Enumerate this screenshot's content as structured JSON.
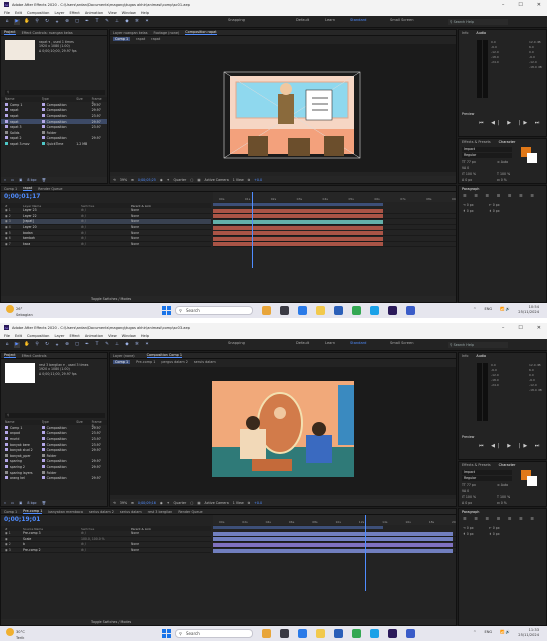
{
  "window_buttons": [
    "–",
    "☐",
    "✕"
  ],
  "menu": [
    "File",
    "Edit",
    "Composition",
    "Layer",
    "Effect",
    "Animation",
    "View",
    "Window",
    "Help"
  ],
  "toolbar": {
    "snapping": "Snapping",
    "workspaces": [
      "Default",
      "Learn",
      "Standard",
      "Small Screen"
    ],
    "search_placeholder": "Search Help"
  },
  "audio": {
    "tabs": [
      "Info",
      "Audio"
    ],
    "db_left": [
      "0.0",
      "-6.0",
      "-12.0",
      "-18.0",
      "-24.0"
    ],
    "db_right": [
      "12.0 dB",
      "6.0",
      "0.0",
      "-6.0",
      "-12.0",
      "-18.0 dB"
    ]
  },
  "preview": {
    "label": "Preview",
    "controls": "⏮ ◀| ▶ |▶ ⏭"
  },
  "character": {
    "tabs": [
      "Effects & Presets",
      "Character"
    ],
    "font": "Impact",
    "style": "Regular",
    "size": "77 px",
    "leading": "Auto",
    "tracking": "0",
    "scale_v": "100 %",
    "scale_h": "100 %",
    "baseline": "0 px",
    "tsume": "0 %",
    "fill_color": "#e07818"
  },
  "paragraph": {
    "label": "Paragraph",
    "indent1": "0 px",
    "indent2": "0 px",
    "space1": "0 px",
    "space2": "0 px"
  },
  "shots": [
    {
      "title": "Adobe After Effects 2020 - C:\\Users\\ardan\\Documents\\magang\\tugas akhir\\animasi\\comp\\sc01.aep",
      "project_tab": "Project",
      "effect_tab": "Effect Controls: ruangan kelas",
      "thumb_name": "rapat ▾ , used 1 times",
      "thumb_info": [
        "1920 x 1080 (1.00)",
        "Δ 0;00;10;00, 29.97 fps"
      ],
      "search_placeholder": "",
      "project_cols": [
        "Name",
        "Type",
        "Size",
        "Frame R..."
      ],
      "project_items": [
        {
          "name": "Comp 1",
          "type": "Composition",
          "size": "",
          "fr": "29.97",
          "color": "lav",
          "sel": false
        },
        {
          "name": "rapat",
          "type": "Composition",
          "size": "",
          "fr": "29.97",
          "color": "lav",
          "sel": false
        },
        {
          "name": "rapat",
          "type": "Composition",
          "size": "",
          "fr": "23.97",
          "color": "lav",
          "sel": false
        },
        {
          "name": "rapat",
          "type": "Composition",
          "size": "",
          "fr": "29.97",
          "color": "lav",
          "sel": true
        },
        {
          "name": "rapat 3",
          "type": "Composition",
          "size": "",
          "fr": "23.97",
          "color": "lav",
          "sel": false
        },
        {
          "name": "Solids",
          "type": "Folder",
          "size": "",
          "fr": "",
          "color": "gray",
          "sel": false
        },
        {
          "name": "rapat 2",
          "type": "Composition",
          "size": "",
          "fr": "29.97",
          "color": "lav",
          "sel": false
        },
        {
          "name": "rapat 3.mov",
          "type": "QuickTime",
          "size": "1.2 MB",
          "fr": "",
          "color": "teal",
          "sel": false
        }
      ],
      "project_foot": "8 bpc",
      "layer_tab": "Layer  ruangan kelas",
      "footage_tab": "Footage  (none)",
      "comp_tab": "Composition  rapat",
      "breadcrumb": [
        "Comp 1",
        "rapat",
        "rapat"
      ],
      "viewer_foot": [
        "39%",
        "0;00;05;25",
        "Quarter",
        "Active Camera",
        "1 View",
        "+0.0"
      ],
      "timeline_tabs": [
        "Comp 1",
        "rapat",
        "Render Queue"
      ],
      "timecode": "0;00;01;17",
      "ruler_ticks": [
        "00s",
        "01s",
        "02s",
        "03s",
        "04s",
        "05s",
        "06s",
        "07s",
        "08s",
        "09s"
      ],
      "tl_cols": [
        "#",
        "Layer Name",
        "Switches",
        "Parent & Link"
      ],
      "layers": [
        {
          "num": "1",
          "name": "Layer 23",
          "sw": "⚙ /",
          "parent": "None",
          "color": "#b85a4a",
          "sel": false
        },
        {
          "num": "2",
          "name": "Layer 22",
          "sw": "⚙ /",
          "parent": "None",
          "color": "#b85a4a",
          "sel": false
        },
        {
          "num": "3",
          "name": "[rapat]",
          "sw": "⚙ /",
          "parent": "None",
          "color": "#6ac0b8",
          "sel": true
        },
        {
          "num": "4",
          "name": "Layer 20",
          "sw": "⚙ /",
          "parent": "None",
          "color": "#b85a4a",
          "sel": false
        },
        {
          "num": "5",
          "name": "badan",
          "sw": "⚙ /",
          "parent": "None",
          "color": "#b85a4a",
          "sel": false
        },
        {
          "num": "6",
          "name": "tambah",
          "sw": "⚙ /",
          "parent": "None",
          "color": "#b85a4a",
          "sel": false
        },
        {
          "num": "7",
          "name": "kaca",
          "sw": "⚙ /",
          "parent": "None",
          "color": "#b85a4a",
          "sel": false
        }
      ],
      "playhead_frac": 0.16,
      "tl_foot": "Toggle Switches / Modes",
      "scene": "meeting",
      "taskbar": {
        "weather1": "26°",
        "weather2": "Sebagian",
        "search": "Search",
        "time": "10:54",
        "date": "25/11/2024",
        "lang": "ENG"
      }
    },
    {
      "title": "Adobe After Effects 2020 - C:\\Users\\ardan\\Documents\\magang\\tugas akhir\\animasi\\comp\\sc03.aep",
      "project_tab": "Project",
      "effect_tab": "Effect Controls",
      "thumb_name": "rest 3 bergilan ▾ , used 3 times",
      "thumb_info": [
        "1920 x 1080 (1.00)",
        "Δ 0;00;11;00, 29.97 fps"
      ],
      "search_placeholder": "",
      "project_cols": [
        "Name",
        "Type",
        "Size",
        "Frame R..."
      ],
      "project_items": [
        {
          "name": "Comp 1",
          "type": "Composition",
          "size": "",
          "fr": "29.97",
          "color": "lav",
          "sel": false
        },
        {
          "name": "anpad",
          "type": "Composition",
          "size": "",
          "fr": "23.97",
          "color": "lav",
          "sel": false
        },
        {
          "name": "murid",
          "type": "Composition",
          "size": "",
          "fr": "23.97",
          "color": "lav",
          "sel": false
        },
        {
          "name": "banyak bere",
          "type": "Composition",
          "size": "",
          "fr": "23.97",
          "color": "lav",
          "sel": false
        },
        {
          "name": "banyak stud 2",
          "type": "Composition",
          "size": "",
          "fr": "29.97",
          "color": "lav",
          "sel": false
        },
        {
          "name": "banyak_pper",
          "type": "Folder",
          "size": "",
          "fr": "",
          "color": "gray",
          "sel": false
        },
        {
          "name": "sparing",
          "type": "Composition",
          "size": "",
          "fr": "29.97",
          "color": "lav",
          "sel": false
        },
        {
          "name": "sparing 2",
          "type": "Composition",
          "size": "",
          "fr": "29.97",
          "color": "lav",
          "sel": false
        },
        {
          "name": "sparing layers",
          "type": "Folder",
          "size": "",
          "fr": "",
          "color": "gray",
          "sel": false
        },
        {
          "name": "orang kel",
          "type": "Composition",
          "size": "",
          "fr": "29.97",
          "color": "lav",
          "sel": false
        }
      ],
      "project_foot": "8 bpc",
      "layer_tab": "Layer  (none)",
      "footage_tab": "",
      "comp_tab": "Composition  Comp 1",
      "breadcrumb": [
        "Comp 1",
        "Pre-comp 1",
        "pergus dalam 2",
        "seruis dalam"
      ],
      "viewer_foot": [
        "39%",
        "0;00;09;16",
        "Quarter",
        "Active Camera",
        "1 View",
        "+0.0"
      ],
      "timeline_tabs": [
        "Comp 1",
        "Pre-comp 1",
        "banyakan membaca",
        "serius dalam 2",
        "serius dalam",
        "rest 3 bergilan",
        "Render Queue"
      ],
      "timecode": "0;00;19;01",
      "ruler_ticks": [
        "00s",
        "02s",
        "04s",
        "06s",
        "08s",
        "10s",
        "12s",
        "14s",
        "16s",
        "18s",
        "20s"
      ],
      "tl_cols": [
        "#",
        "Source Name",
        "Switches",
        "Parent & Link"
      ],
      "layers": [
        {
          "num": "1",
          "name": "Pre-comp 3",
          "sw": "⚙ /",
          "parent": "None",
          "color": "#7a8ad0",
          "sel": false
        },
        {
          "name": "Scale",
          "num": "",
          "sw": "100.0, 100.0 %",
          "parent": "",
          "color": "#7a8ad0",
          "sel": false
        },
        {
          "num": "2",
          "name": "b",
          "sw": "⚙ /",
          "parent": "None",
          "color": "#8a7ad0",
          "sel": false
        },
        {
          "num": "3",
          "name": "Pre-comp 2",
          "sw": "⚙ /",
          "parent": "None",
          "color": "#7a8ad0",
          "sel": false
        }
      ],
      "playhead_frac": 0.62,
      "tl_foot": "Toggle Switches / Modes",
      "scene": "reading",
      "taskbar": {
        "weather1": "30°C",
        "weather2": "Terik",
        "search": "Search",
        "time": "11:33",
        "date": "25/11/2024",
        "lang": "ENG"
      }
    }
  ]
}
